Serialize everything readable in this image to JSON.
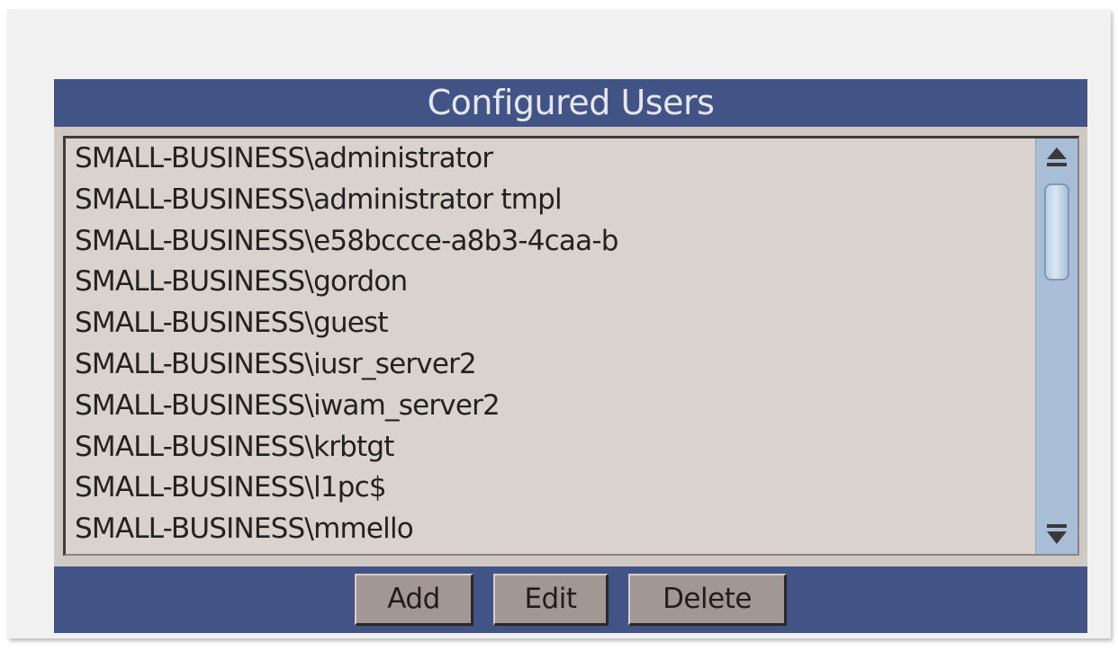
{
  "panel": {
    "title": "Configured Users"
  },
  "users": [
    "SMALL-BUSINESS\\administrator",
    "SMALL-BUSINESS\\administrator tmpl",
    "SMALL-BUSINESS\\e58bccce-a8b3-4caa-b",
    "SMALL-BUSINESS\\gordon",
    "SMALL-BUSINESS\\guest",
    "SMALL-BUSINESS\\iusr_server2",
    "SMALL-BUSINESS\\iwam_server2",
    "SMALL-BUSINESS\\krbtgt",
    "SMALL-BUSINESS\\l1pc$",
    "SMALL-BUSINESS\\mmello"
  ],
  "scrollbar": {
    "up_icon": "scroll-up-arrow",
    "down_icon": "scroll-down-arrow",
    "position": 0.0
  },
  "actions": {
    "add_label": "Add",
    "edit_label": "Edit",
    "delete_label": "Delete"
  },
  "colors": {
    "header_bar": "#425486",
    "list_background": "#dad2cd",
    "button_face": "#a29795",
    "scrollbar_track": "#a9bed6"
  }
}
